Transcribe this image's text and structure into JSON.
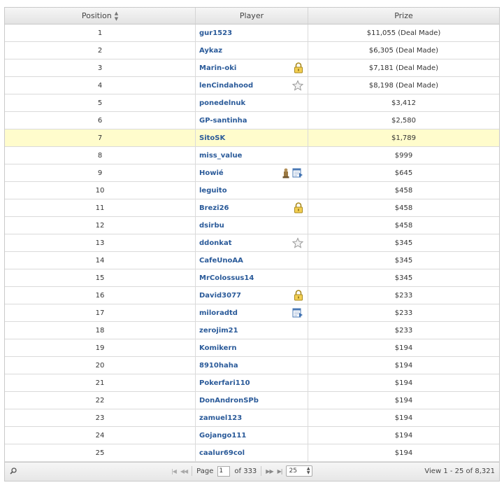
{
  "table": {
    "columns": {
      "position": "Position",
      "player": "Player",
      "prize": "Prize"
    },
    "highlight_color": "#fffccc",
    "link_color": "#2a5a99",
    "rows": [
      {
        "position": "1",
        "player": "gur1523",
        "prize": "$11,055 (Deal Made)",
        "icons": []
      },
      {
        "position": "2",
        "player": "Aykaz",
        "prize": "$6,305 (Deal Made)",
        "icons": []
      },
      {
        "position": "3",
        "player": "Marin-oki",
        "prize": "$7,181 (Deal Made)",
        "icons": [
          "lock-icon"
        ]
      },
      {
        "position": "4",
        "player": "lenCindahood",
        "prize": "$8,198 (Deal Made)",
        "icons": [
          "star-icon"
        ]
      },
      {
        "position": "5",
        "player": "ponedelnuk",
        "prize": "$3,412",
        "icons": []
      },
      {
        "position": "6",
        "player": "GP-santinha",
        "prize": "$2,580",
        "icons": []
      },
      {
        "position": "7",
        "player": "SitoSK",
        "prize": "$1,789",
        "icons": [],
        "highlighted": true
      },
      {
        "position": "8",
        "player": "miss_value",
        "prize": "$999",
        "icons": []
      },
      {
        "position": "9",
        "player": "Howié",
        "prize": "$645",
        "icons": [
          "trophy-icon",
          "schedule-icon"
        ]
      },
      {
        "position": "10",
        "player": "leguito",
        "prize": "$458",
        "icons": []
      },
      {
        "position": "11",
        "player": "Brezi26",
        "prize": "$458",
        "icons": [
          "lock-icon"
        ]
      },
      {
        "position": "12",
        "player": "dsirbu",
        "prize": "$458",
        "icons": []
      },
      {
        "position": "13",
        "player": "ddonkat",
        "prize": "$345",
        "icons": [
          "star-icon"
        ]
      },
      {
        "position": "14",
        "player": "CafeUnoAA",
        "prize": "$345",
        "icons": []
      },
      {
        "position": "15",
        "player": "MrColossus14",
        "prize": "$345",
        "icons": []
      },
      {
        "position": "16",
        "player": "David3077",
        "prize": "$233",
        "icons": [
          "lock-icon"
        ]
      },
      {
        "position": "17",
        "player": "miloradtd",
        "prize": "$233",
        "icons": [
          "schedule-icon"
        ]
      },
      {
        "position": "18",
        "player": "zerojim21",
        "prize": "$233",
        "icons": []
      },
      {
        "position": "19",
        "player": "Komikern",
        "prize": "$194",
        "icons": []
      },
      {
        "position": "20",
        "player": "8910haha",
        "prize": "$194",
        "icons": []
      },
      {
        "position": "21",
        "player": "Pokerfari110",
        "prize": "$194",
        "icons": []
      },
      {
        "position": "22",
        "player": "DonAndronSPb",
        "prize": "$194",
        "icons": []
      },
      {
        "position": "23",
        "player": "zamuel123",
        "prize": "$194",
        "icons": []
      },
      {
        "position": "24",
        "player": "Gojango111",
        "prize": "$194",
        "icons": []
      },
      {
        "position": "25",
        "player": "caalur69col",
        "prize": "$194",
        "icons": []
      }
    ]
  },
  "pager": {
    "page_label": "Page",
    "page_value": "1",
    "of_label": "of 333",
    "page_size": "25",
    "view_text": "View 1 - 25 of 8,321"
  }
}
